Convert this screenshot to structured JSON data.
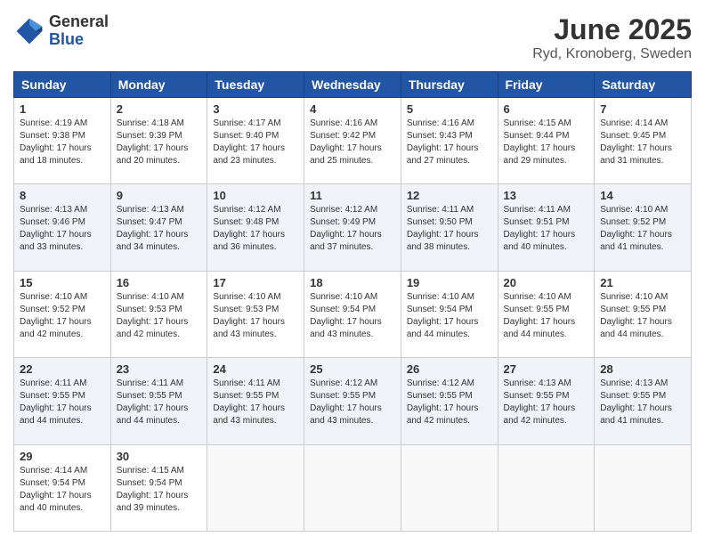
{
  "logo": {
    "general": "General",
    "blue": "Blue"
  },
  "title": "June 2025",
  "subtitle": "Ryd, Kronoberg, Sweden",
  "days_header": [
    "Sunday",
    "Monday",
    "Tuesday",
    "Wednesday",
    "Thursday",
    "Friday",
    "Saturday"
  ],
  "weeks": [
    [
      {
        "day": "1",
        "sunrise": "4:19 AM",
        "sunset": "9:38 PM",
        "daylight": "17 hours and 18 minutes."
      },
      {
        "day": "2",
        "sunrise": "4:18 AM",
        "sunset": "9:39 PM",
        "daylight": "17 hours and 20 minutes."
      },
      {
        "day": "3",
        "sunrise": "4:17 AM",
        "sunset": "9:40 PM",
        "daylight": "17 hours and 23 minutes."
      },
      {
        "day": "4",
        "sunrise": "4:16 AM",
        "sunset": "9:42 PM",
        "daylight": "17 hours and 25 minutes."
      },
      {
        "day": "5",
        "sunrise": "4:16 AM",
        "sunset": "9:43 PM",
        "daylight": "17 hours and 27 minutes."
      },
      {
        "day": "6",
        "sunrise": "4:15 AM",
        "sunset": "9:44 PM",
        "daylight": "17 hours and 29 minutes."
      },
      {
        "day": "7",
        "sunrise": "4:14 AM",
        "sunset": "9:45 PM",
        "daylight": "17 hours and 31 minutes."
      }
    ],
    [
      {
        "day": "8",
        "sunrise": "4:13 AM",
        "sunset": "9:46 PM",
        "daylight": "17 hours and 33 minutes."
      },
      {
        "day": "9",
        "sunrise": "4:13 AM",
        "sunset": "9:47 PM",
        "daylight": "17 hours and 34 minutes."
      },
      {
        "day": "10",
        "sunrise": "4:12 AM",
        "sunset": "9:48 PM",
        "daylight": "17 hours and 36 minutes."
      },
      {
        "day": "11",
        "sunrise": "4:12 AM",
        "sunset": "9:49 PM",
        "daylight": "17 hours and 37 minutes."
      },
      {
        "day": "12",
        "sunrise": "4:11 AM",
        "sunset": "9:50 PM",
        "daylight": "17 hours and 38 minutes."
      },
      {
        "day": "13",
        "sunrise": "4:11 AM",
        "sunset": "9:51 PM",
        "daylight": "17 hours and 40 minutes."
      },
      {
        "day": "14",
        "sunrise": "4:10 AM",
        "sunset": "9:52 PM",
        "daylight": "17 hours and 41 minutes."
      }
    ],
    [
      {
        "day": "15",
        "sunrise": "4:10 AM",
        "sunset": "9:52 PM",
        "daylight": "17 hours and 42 minutes."
      },
      {
        "day": "16",
        "sunrise": "4:10 AM",
        "sunset": "9:53 PM",
        "daylight": "17 hours and 42 minutes."
      },
      {
        "day": "17",
        "sunrise": "4:10 AM",
        "sunset": "9:53 PM",
        "daylight": "17 hours and 43 minutes."
      },
      {
        "day": "18",
        "sunrise": "4:10 AM",
        "sunset": "9:54 PM",
        "daylight": "17 hours and 43 minutes."
      },
      {
        "day": "19",
        "sunrise": "4:10 AM",
        "sunset": "9:54 PM",
        "daylight": "17 hours and 44 minutes."
      },
      {
        "day": "20",
        "sunrise": "4:10 AM",
        "sunset": "9:55 PM",
        "daylight": "17 hours and 44 minutes."
      },
      {
        "day": "21",
        "sunrise": "4:10 AM",
        "sunset": "9:55 PM",
        "daylight": "17 hours and 44 minutes."
      }
    ],
    [
      {
        "day": "22",
        "sunrise": "4:11 AM",
        "sunset": "9:55 PM",
        "daylight": "17 hours and 44 minutes."
      },
      {
        "day": "23",
        "sunrise": "4:11 AM",
        "sunset": "9:55 PM",
        "daylight": "17 hours and 44 minutes."
      },
      {
        "day": "24",
        "sunrise": "4:11 AM",
        "sunset": "9:55 PM",
        "daylight": "17 hours and 43 minutes."
      },
      {
        "day": "25",
        "sunrise": "4:12 AM",
        "sunset": "9:55 PM",
        "daylight": "17 hours and 43 minutes."
      },
      {
        "day": "26",
        "sunrise": "4:12 AM",
        "sunset": "9:55 PM",
        "daylight": "17 hours and 42 minutes."
      },
      {
        "day": "27",
        "sunrise": "4:13 AM",
        "sunset": "9:55 PM",
        "daylight": "17 hours and 42 minutes."
      },
      {
        "day": "28",
        "sunrise": "4:13 AM",
        "sunset": "9:55 PM",
        "daylight": "17 hours and 41 minutes."
      }
    ],
    [
      {
        "day": "29",
        "sunrise": "4:14 AM",
        "sunset": "9:54 PM",
        "daylight": "17 hours and 40 minutes."
      },
      {
        "day": "30",
        "sunrise": "4:15 AM",
        "sunset": "9:54 PM",
        "daylight": "17 hours and 39 minutes."
      },
      null,
      null,
      null,
      null,
      null
    ]
  ]
}
